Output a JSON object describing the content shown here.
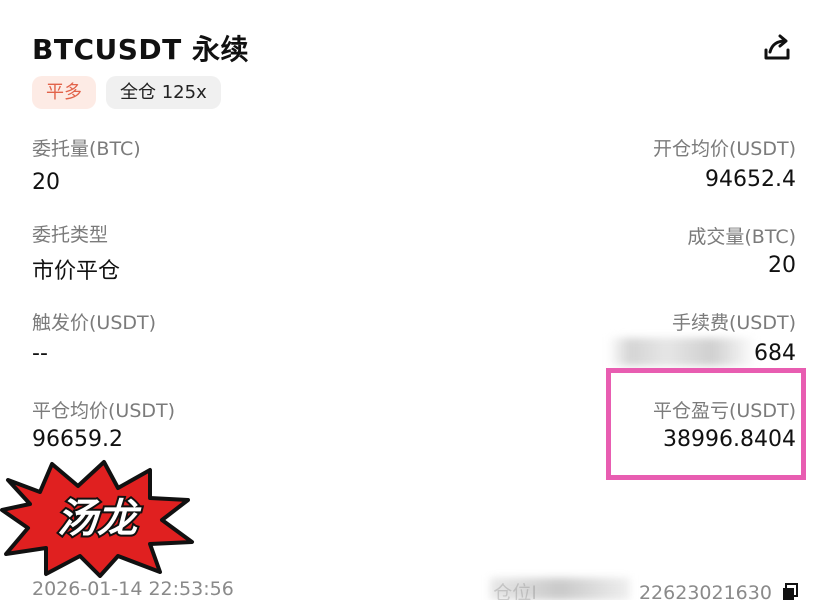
{
  "header": {
    "title": "BTCUSDT 永续",
    "share_icon": "share-icon"
  },
  "tags": {
    "side": "平多",
    "mode": "全仓 125x"
  },
  "fields": {
    "order_qty_label": "委托量(BTC)",
    "order_qty_value": "20",
    "open_avg_label": "开仓均价(USDT)",
    "open_avg_value": "94652.4",
    "order_type_label": "委托类型",
    "order_type_value": "市价平仓",
    "filled_qty_label": "成交量(BTC)",
    "filled_qty_value": "20",
    "trigger_label": "触发价(USDT)",
    "trigger_value": "--",
    "fee_label": "手续费(USDT)",
    "fee_value": "684",
    "close_avg_label": "平仓均价(USDT)",
    "close_avg_value": "96659.2",
    "pnl_label": "平仓盈亏(USDT)",
    "pnl_value": "38996.8404"
  },
  "stamp": {
    "text": "汤龙"
  },
  "footer": {
    "time": "2026-01-14 22:53:56",
    "position_id_prefix": "仓位I",
    "position_id": "22623021630"
  },
  "colors": {
    "accent_orange": "#e2634a",
    "highlight_pink": "#e85db1",
    "stamp_red": "#e02020"
  }
}
